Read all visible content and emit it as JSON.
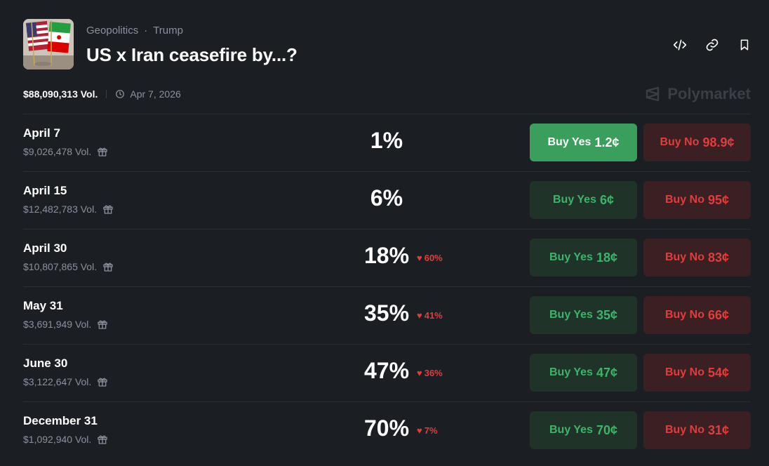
{
  "header": {
    "category": "Geopolitics",
    "subcategory": "Trump",
    "separator": "·",
    "title": "US x Iran ceasefire by...?",
    "actions": [
      {
        "icon": "code-embed-icon"
      },
      {
        "icon": "link-icon"
      },
      {
        "icon": "bookmark-icon"
      }
    ]
  },
  "meta": {
    "total_volume": "$88,090,313 Vol.",
    "end_date": "Apr 7, 2026"
  },
  "brand": {
    "name": "Polymarket"
  },
  "colors": {
    "background": "#1b1e23",
    "yes_green": "#3db468",
    "yes_active": "#3a9f5d",
    "no_red": "#e23d3d"
  },
  "outcomes": [
    {
      "label": "April 7",
      "volume": "$9,026,478 Vol.",
      "probability": "1%",
      "change": "",
      "yes_text": "Buy Yes",
      "yes_price": "1.2¢",
      "no_text": "Buy No",
      "no_price": "98.9¢"
    },
    {
      "label": "April 15",
      "volume": "$12,482,783 Vol.",
      "probability": "6%",
      "change": "",
      "yes_text": "Buy Yes",
      "yes_price": "6¢",
      "no_text": "Buy No",
      "no_price": "95¢"
    },
    {
      "label": "April 30",
      "volume": "$10,807,865 Vol.",
      "probability": "18%",
      "change": "60%",
      "yes_text": "Buy Yes",
      "yes_price": "18¢",
      "no_text": "Buy No",
      "no_price": "83¢"
    },
    {
      "label": "May 31",
      "volume": "$3,691,949 Vol.",
      "probability": "35%",
      "change": "41%",
      "yes_text": "Buy Yes",
      "yes_price": "35¢",
      "no_text": "Buy No",
      "no_price": "66¢"
    },
    {
      "label": "June 30",
      "volume": "$3,122,647 Vol.",
      "probability": "47%",
      "change": "36%",
      "yes_text": "Buy Yes",
      "yes_price": "47¢",
      "no_text": "Buy No",
      "no_price": "54¢"
    },
    {
      "label": "December 31",
      "volume": "$1,092,940 Vol.",
      "probability": "70%",
      "change": "7%",
      "yes_text": "Buy Yes",
      "yes_price": "70¢",
      "no_text": "Buy No",
      "no_price": "31¢"
    }
  ]
}
